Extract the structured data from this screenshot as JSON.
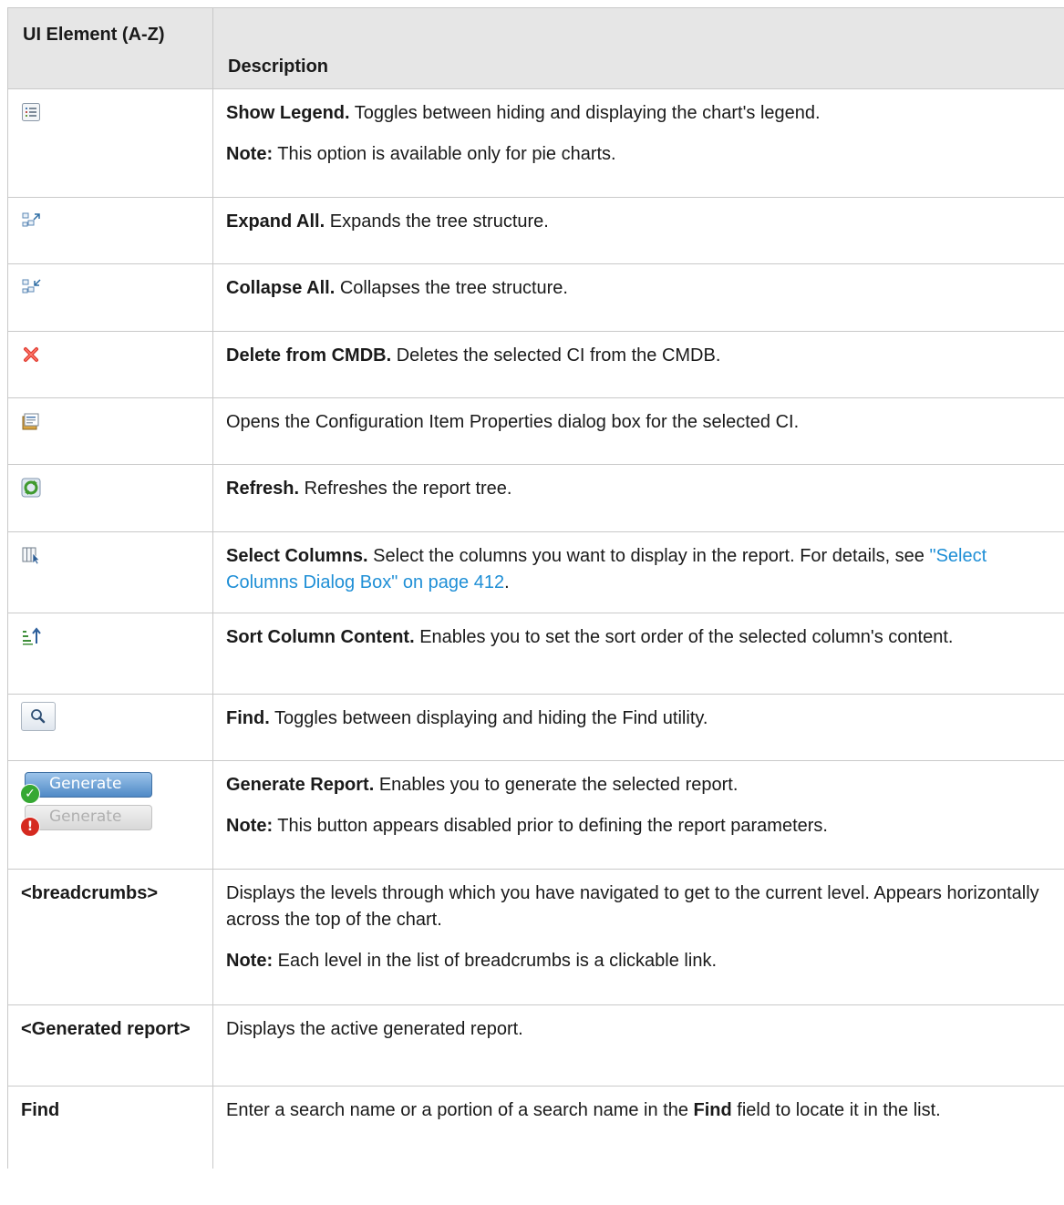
{
  "header": {
    "col1": "UI Element (A-Z)",
    "col2": "Description"
  },
  "rows": [
    {
      "icon": "show-legend-icon",
      "lead": "Show Legend.",
      "text": " Toggles between hiding and displaying the chart's legend.",
      "note_label": "Note:",
      "note_text": " This option is available only for pie charts."
    },
    {
      "icon": "expand-all-icon",
      "lead": "Expand All.",
      "text": " Expands the tree structure."
    },
    {
      "icon": "collapse-all-icon",
      "lead": "Collapse All.",
      "text": " Collapses the tree structure."
    },
    {
      "icon": "delete-icon",
      "lead": "Delete from CMDB.",
      "text": " Deletes the selected CI from the CMDB."
    },
    {
      "icon": "properties-icon",
      "text": "Opens the Configuration Item Properties dialog box for the selected CI."
    },
    {
      "icon": "refresh-icon",
      "lead": "Refresh.",
      "text": " Refreshes the report tree."
    },
    {
      "icon": "select-columns-icon",
      "lead": "Select Columns.",
      "text": " Select the columns you want to display in the report. For details, see ",
      "link": "\"Select Columns Dialog Box\" on page 412",
      "text_after": "."
    },
    {
      "icon": "sort-icon",
      "lead": "Sort Column Content.",
      "text": " Enables you to set the sort order of the selected column's content."
    },
    {
      "icon": "find-icon",
      "lead": "Find.",
      "text": " Toggles between displaying and hiding the Find utility."
    },
    {
      "icon": "generate-buttons",
      "button_label": "Generate",
      "lead": "Generate Report.",
      "text": " Enables you to generate the selected report.",
      "note_label": "Note:",
      "note_text": " This button appears disabled prior to defining the report parameters."
    },
    {
      "element": "<breadcrumbs>",
      "text": "Displays the levels through which you have navigated to get to the current level. Appears horizontally across the top of the chart.",
      "note_label": "Note:",
      "note_text": " Each level in the list of breadcrumbs is a clickable link."
    },
    {
      "element": "<Generated report>",
      "text": "Displays the active generated report."
    },
    {
      "element": "Find",
      "text_before": "Enter a search name or a portion of a search name in the ",
      "bold": "Find",
      "text": " field to locate it in the list."
    }
  ],
  "colors": {
    "header_bg": "#e6e6e6",
    "border": "#c9c9c9",
    "link": "#1f8fd6"
  }
}
